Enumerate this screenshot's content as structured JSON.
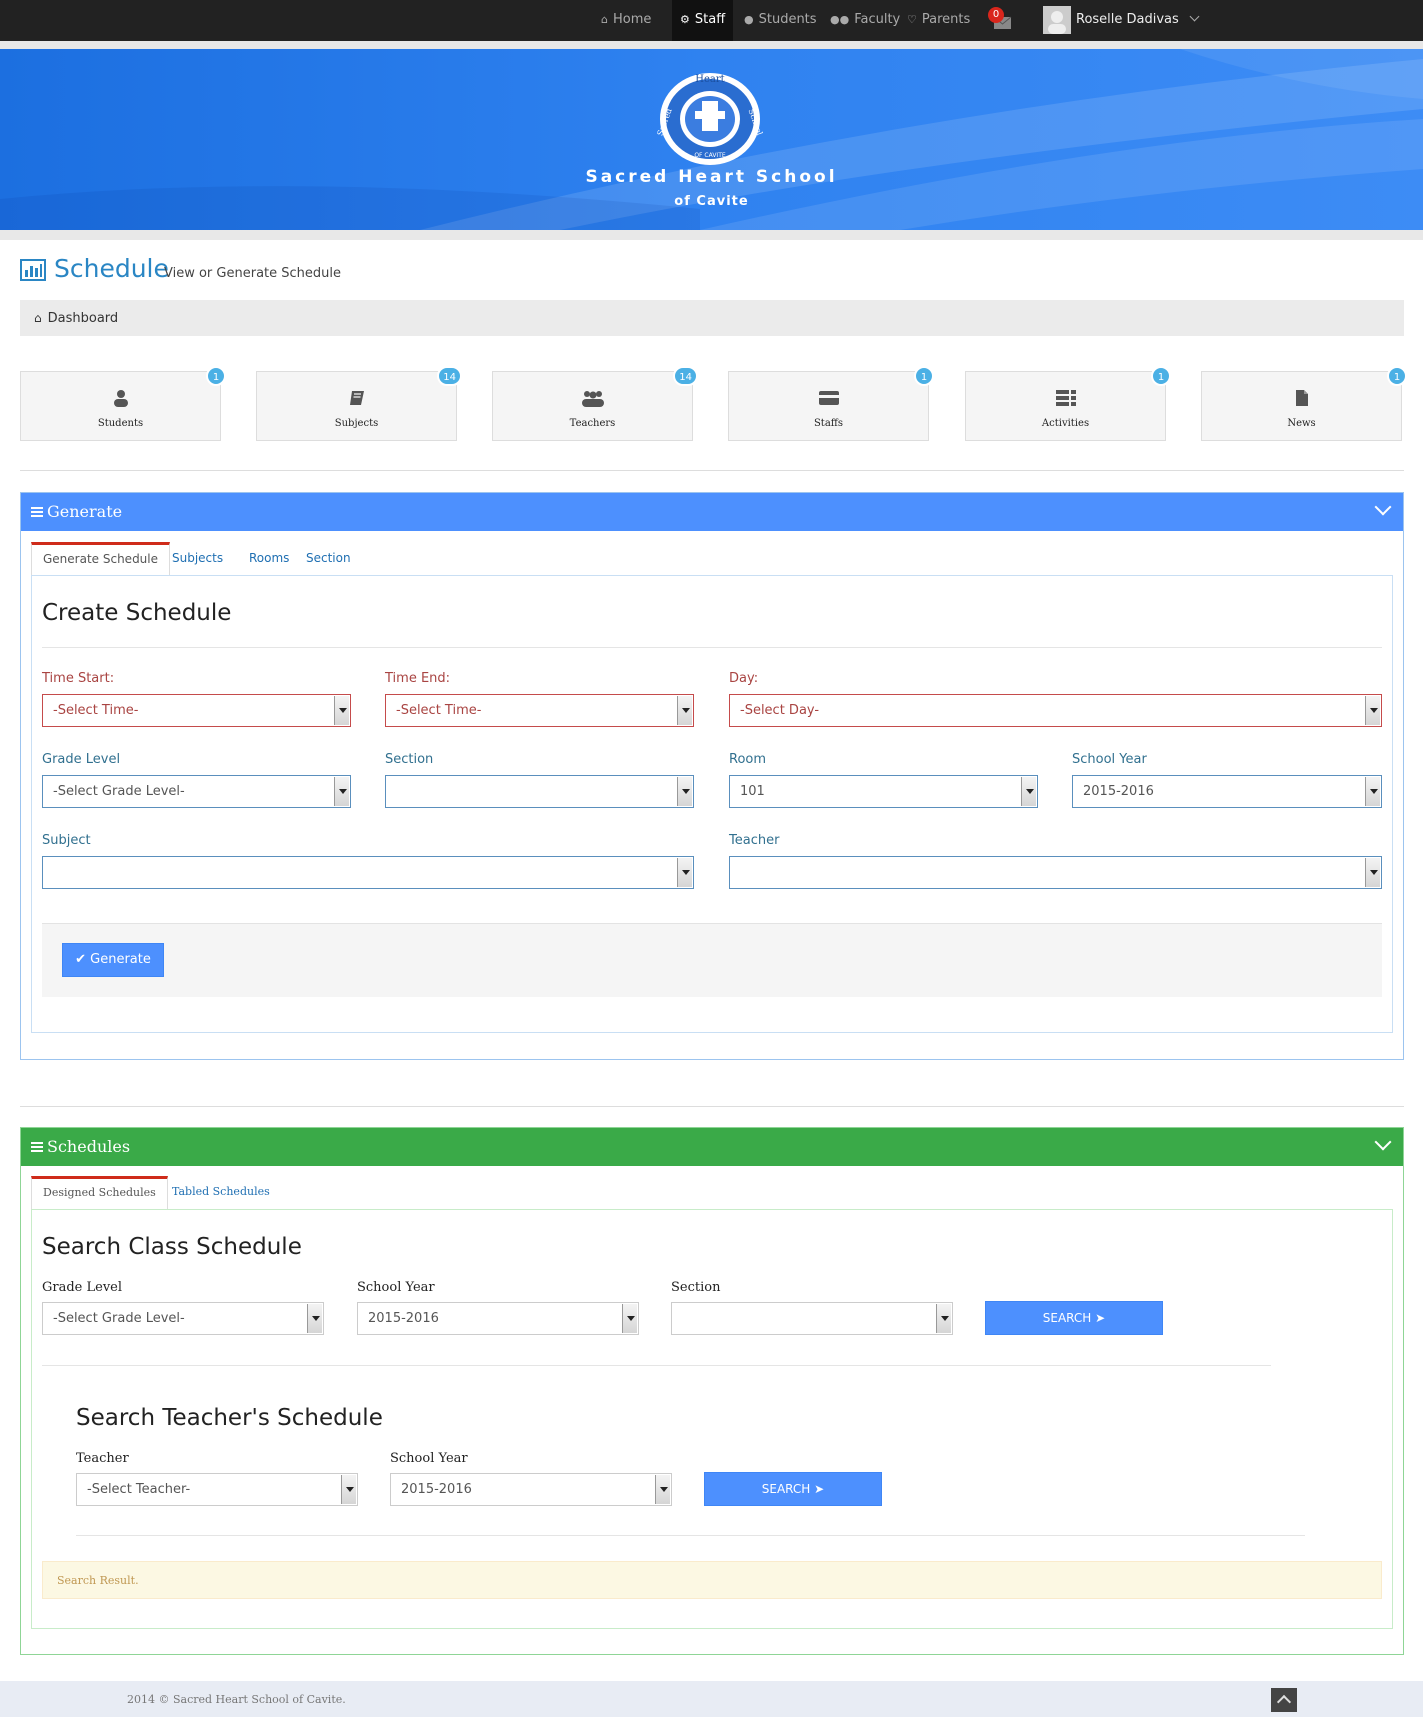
{
  "nav": {
    "items": [
      {
        "label": "Home",
        "icon": "home-icon"
      },
      {
        "label": "Staff",
        "icon": "gear-icon",
        "active": true
      },
      {
        "label": "Students",
        "icon": "user-icon"
      },
      {
        "label": "Faculty",
        "icon": "users-icon"
      },
      {
        "label": "Parents",
        "icon": "heart-icon"
      }
    ],
    "mail_count": "0",
    "user_name": "Roselle Dadivas"
  },
  "banner": {
    "logo_top_text": "Heart",
    "logo_left_text": "Sacred",
    "logo_right_text": "School",
    "logo_bottom_text": "OF CAVITE",
    "title": "Sacred Heart School",
    "subtitle": "of Cavite"
  },
  "page": {
    "title": "Schedule",
    "subtitle": "View or Generate Schedule",
    "breadcrumb": "Dashboard"
  },
  "tiles": [
    {
      "label": "Students",
      "badge": "1",
      "icon": "user-icon"
    },
    {
      "label": "Subjects",
      "badge": "14",
      "icon": "book-icon"
    },
    {
      "label": "Teachers",
      "badge": "14",
      "icon": "users-icon"
    },
    {
      "label": "Staffs",
      "badge": "1",
      "icon": "card-icon"
    },
    {
      "label": "Activities",
      "badge": "1",
      "icon": "list-icon"
    },
    {
      "label": "News",
      "badge": "1",
      "icon": "file-icon"
    }
  ],
  "generate": {
    "panel_title": "Generate",
    "tabs": [
      "Generate Schedule",
      "Subjects",
      "Rooms",
      "Section"
    ],
    "heading": "Create Schedule",
    "fields": {
      "time_start": {
        "label": "Time Start:",
        "value": "-Select Time-"
      },
      "time_end": {
        "label": "Time End:",
        "value": "-Select Time-"
      },
      "day": {
        "label": "Day:",
        "value": "-Select Day-"
      },
      "grade_level": {
        "label": "Grade Level",
        "value": "-Select Grade Level-"
      },
      "section": {
        "label": "Section",
        "value": ""
      },
      "room": {
        "label": "Room",
        "value": "101"
      },
      "school_year": {
        "label": "School Year",
        "value": "2015-2016"
      },
      "subject": {
        "label": "Subject",
        "value": ""
      },
      "teacher": {
        "label": "Teacher",
        "value": ""
      }
    },
    "button": "Generate"
  },
  "schedules": {
    "panel_title": "Schedules",
    "tabs": [
      "Designed Schedules",
      "Tabled Schedules"
    ],
    "class_heading": "Search Class Schedule",
    "class_fields": {
      "grade_level": {
        "label": "Grade Level",
        "value": "-Select Grade Level-"
      },
      "school_year": {
        "label": "School Year",
        "value": "2015-2016"
      },
      "section": {
        "label": "Section",
        "value": ""
      }
    },
    "search_button": "SEARCH",
    "teacher_heading": "Search Teacher's Schedule",
    "teacher_fields": {
      "teacher": {
        "label": "Teacher",
        "value": "-Select Teacher-"
      },
      "school_year": {
        "label": "School Year",
        "value": "2015-2016"
      }
    },
    "result_text": "Search Result."
  },
  "footer": {
    "text": "2014 © Sacred Heart School of Cavite."
  },
  "colors": {
    "generate_header": "#4d90fe",
    "schedules_header": "#3aaa48",
    "accent_tab": "#cf2b1a",
    "badge": "#4bb0e5"
  }
}
